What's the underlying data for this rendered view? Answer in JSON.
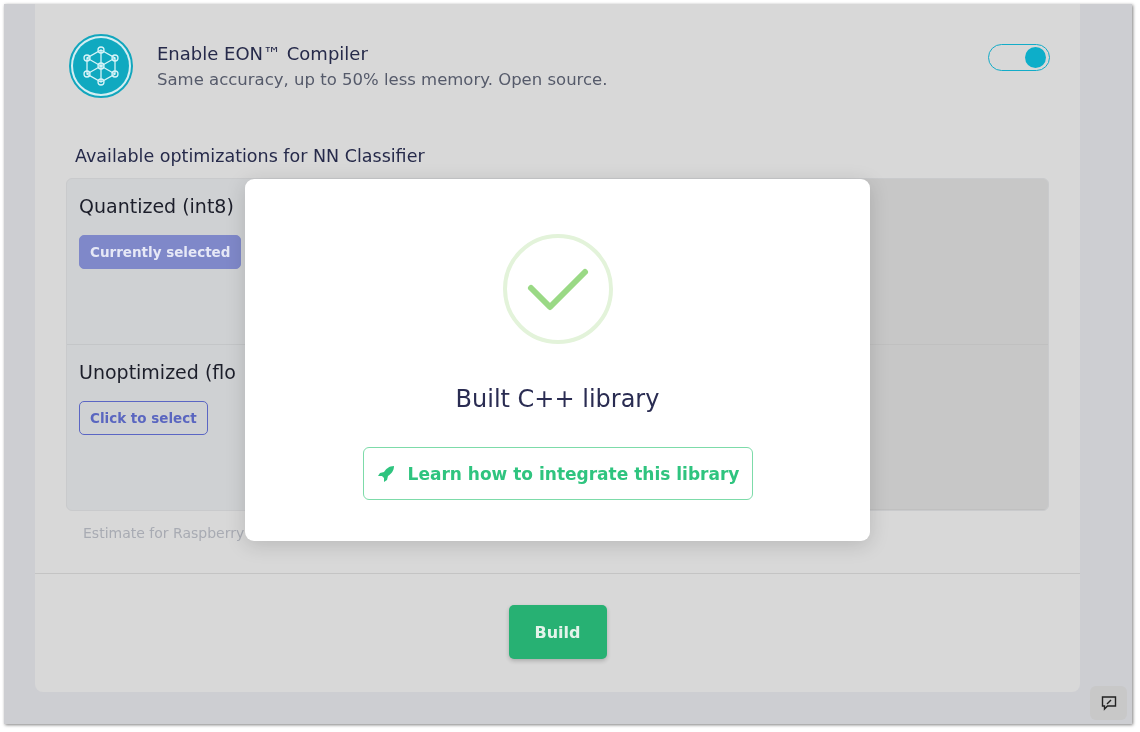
{
  "eon_compiler": {
    "title": "Enable EON™ Compiler",
    "description": "Same accuracy, up to 50% less memory. Open source.",
    "on": true
  },
  "optimizations": {
    "title": "Available optimizations for NN Classifier",
    "options": [
      {
        "name": "Quantized (int8)",
        "button": "Currently selected",
        "selected": true
      },
      {
        "name": "Unoptimized (flo",
        "button": "Click to select",
        "selected": false
      }
    ],
    "footnote": "Estimate for Raspberry"
  },
  "build_button": "Build",
  "dialog": {
    "title": "Built C++ library",
    "link_button": "Learn how to integrate this library"
  }
}
